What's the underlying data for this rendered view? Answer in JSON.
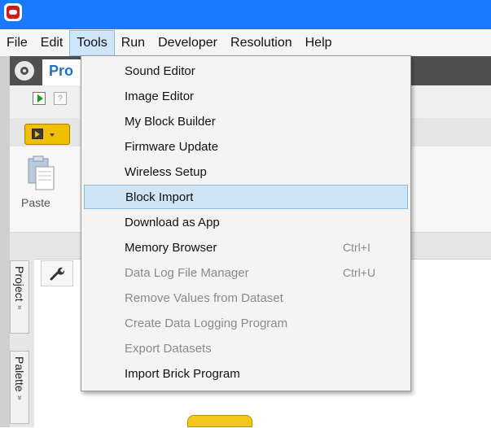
{
  "menubar": {
    "items": [
      {
        "label": "File"
      },
      {
        "label": "Edit"
      },
      {
        "label": "Tools"
      },
      {
        "label": "Run"
      },
      {
        "label": "Developer"
      },
      {
        "label": "Resolution"
      },
      {
        "label": "Help"
      }
    ],
    "active": "Tools"
  },
  "project": {
    "tab_label": "Pro"
  },
  "ribbon": {
    "paste_label": "Paste"
  },
  "side_tabs": {
    "project": "Project",
    "palette": "Palette",
    "arrow": "»"
  },
  "help_glyph": "?",
  "tools_menu": {
    "items": [
      {
        "label": "Sound Editor",
        "shortcut": "",
        "enabled": true
      },
      {
        "label": "Image Editor",
        "shortcut": "",
        "enabled": true
      },
      {
        "label": "My Block Builder",
        "shortcut": "",
        "enabled": true
      },
      {
        "label": "Firmware Update",
        "shortcut": "",
        "enabled": true
      },
      {
        "label": "Wireless Setup",
        "shortcut": "",
        "enabled": true
      },
      {
        "label": "Block Import",
        "shortcut": "",
        "enabled": true,
        "highlighted": true
      },
      {
        "label": "Download as App",
        "shortcut": "",
        "enabled": true
      },
      {
        "label": "Memory Browser",
        "shortcut": "Ctrl+I",
        "enabled": true
      },
      {
        "label": "Data Log File Manager",
        "shortcut": "Ctrl+U",
        "enabled": false
      },
      {
        "label": "Remove Values from Dataset",
        "shortcut": "",
        "enabled": false
      },
      {
        "label": "Create Data Logging Program",
        "shortcut": "",
        "enabled": false
      },
      {
        "label": "Export Datasets",
        "shortcut": "",
        "enabled": false
      },
      {
        "label": "Import Brick Program",
        "shortcut": "",
        "enabled": true
      }
    ]
  },
  "colors": {
    "titlebar": "#1979ff",
    "highlight": "#cfe5f5",
    "disabled_text": "#8a8a8a",
    "brand_red": "#cf1b1b",
    "accent_yellow": "#f0c000"
  }
}
